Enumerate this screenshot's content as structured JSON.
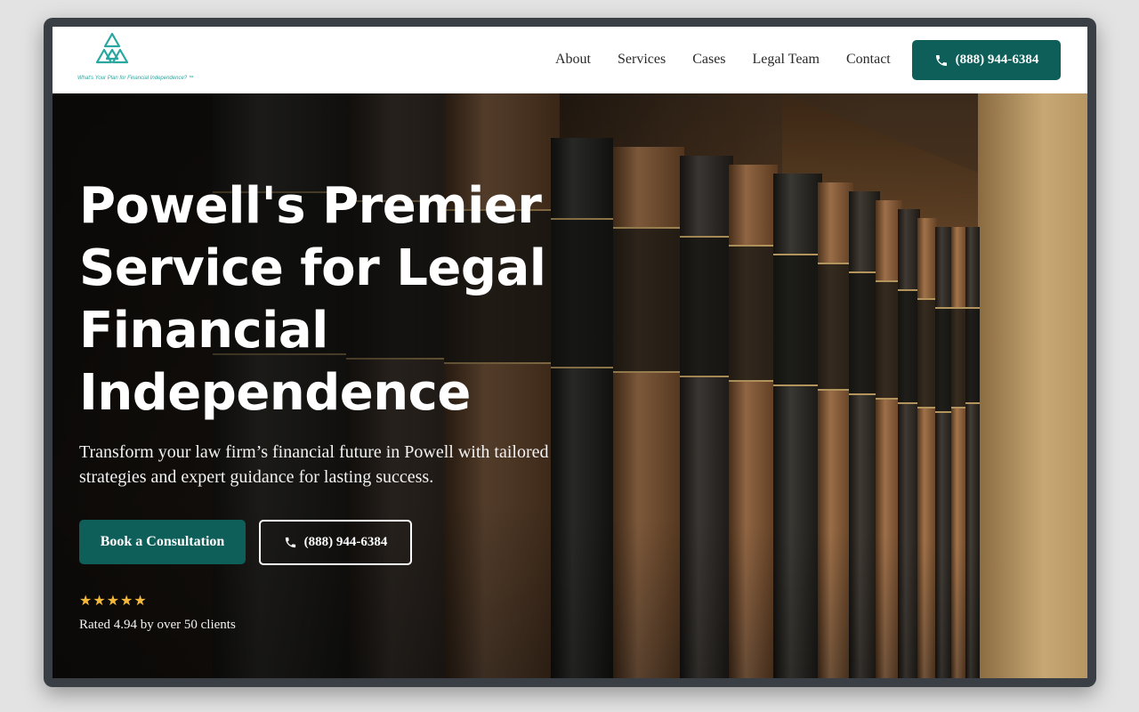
{
  "header": {
    "logo_tagline": "What's Your Plan for Financial Independence? ™",
    "nav": [
      {
        "label": "About"
      },
      {
        "label": "Services"
      },
      {
        "label": "Cases"
      },
      {
        "label": "Legal Team"
      },
      {
        "label": "Contact"
      }
    ],
    "phone_label": "(888) 944-6384"
  },
  "hero": {
    "title": "Powell's Premier Service for Legal Financial Independence",
    "subtitle": "Transform your law firm’s financial future in Powell with tailored strategies and expert guidance for lasting success.",
    "primary_button": "Book a Consultation",
    "secondary_button": "(888) 944-6384",
    "stars": "★★★★★",
    "rating_text": "Rated 4.94 by over 50 clients"
  },
  "colors": {
    "brand": "#0e5f5a",
    "logo": "#2aa7a0",
    "star": "#f4b93a"
  },
  "icons": [
    "logo-triangles-icon",
    "phone-icon"
  ]
}
